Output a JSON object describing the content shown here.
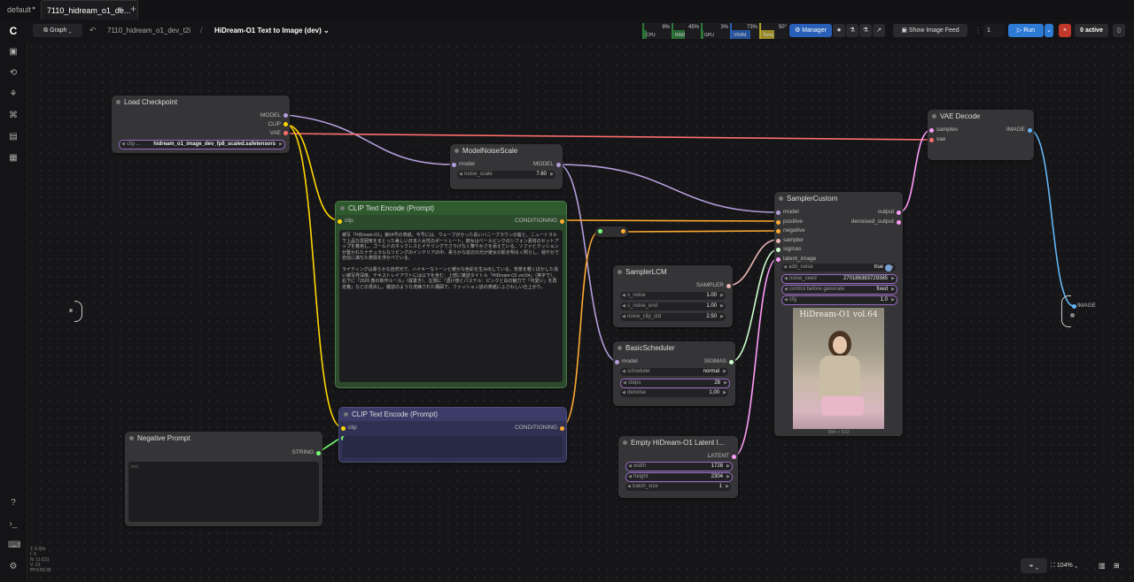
{
  "tabs": [
    {
      "label": "default"
    },
    {
      "label": "7110_hidream_o1_de..."
    }
  ],
  "topbar": {
    "graph_label": "Graph",
    "workflow_path": "7110_hidream_o1_dev_t2i",
    "workflow_title": "HiDream-O1 Text to Image (dev)",
    "stats": [
      {
        "label": "CPU",
        "value": "9%",
        "color": "#2d7a3a"
      },
      {
        "label": "RAM",
        "value": "45%",
        "color": "#2d7a3a"
      },
      {
        "label": "GPU",
        "value": "3%",
        "color": "#2d7a3a"
      },
      {
        "label": "VRAM",
        "value": "73%",
        "color": "#2860b8"
      },
      {
        "label": "Temp",
        "value": "50°",
        "color": "#b8a52a"
      }
    ],
    "manager_label": "Manager",
    "show_feed_label": "Show Image Feed",
    "queue_count": "1",
    "run_label": "Run",
    "active_label": "0 active"
  },
  "nodes": {
    "load_checkpoint": {
      "title": "Load Checkpoint",
      "outputs": [
        "MODEL",
        "CLIP",
        "VAE"
      ],
      "ckpt_label": "clip ...",
      "ckpt_value": "hidream_o1_image_dev_fp8_scaled.safetensors"
    },
    "model_noise_scale": {
      "title": "ModelNoiseScale",
      "input": "model",
      "output": "MODEL",
      "widget_label": "noise_scale",
      "widget_value": "7.60"
    },
    "clip_pos": {
      "title": "CLIP Text Encode (Prompt)",
      "input": "clip",
      "output": "CONDITIONING",
      "text": "被写「HiDream-O1」第64号の表紙。今号には、ウェーブがかった長いハニーブラウンの髪と、ニュートラルで上品な雰囲気をまとった美しい日本人女性のポートレート。彼女はベールピンクのシフォン素材のセットアップを着用し、ゴールドのネックレスとイヤリングでさりげなく華やかさを添えている。ソファとクッションが置かれたナチュラルなリビングのインテリアの中、柔らかな窓辺の光が彼女の肌を明るく照らし、穏やかで自信に満ちた表情を浮かべている。\n\nライティングは柔らかな自然光で、ハイキーなトーンと暖かな色彩を生み出している。背景を軽くぼかした浅い被写界深度。テキストレイアウトには以下を含む：上部に雑誌タイトル「HiDream-O1 vol.64」（英字で）、右下に「2026 春の新作ルール」（縦書き）、左側に「透け感とパステル：ピンクと白の魅力で「可愛い」を再定義」などの見出し。雑誌のような洗練された構図で、ファッション誌の表紙にふさわしい仕上がり。"
    },
    "clip_neg": {
      "title": "CLIP Text Encode (Prompt)",
      "input": "clip",
      "output": "CONDITIONING"
    },
    "negative_prompt": {
      "title": "Negative Prompt",
      "output": "STRING",
      "placeholder": "text"
    },
    "sampler_lcm": {
      "title": "SamplerLCM",
      "output": "SAMPLER",
      "widgets": [
        {
          "label": "s_noise",
          "value": "1.00"
        },
        {
          "label": "s_noise_end",
          "value": "1.00"
        },
        {
          "label": "noise_clip_std",
          "value": "2.50"
        }
      ]
    },
    "basic_scheduler": {
      "title": "BasicScheduler",
      "input": "model",
      "output": "SIGMAS",
      "widgets": [
        {
          "label": "scheduler",
          "value": "normal"
        },
        {
          "label": "steps",
          "value": "28"
        },
        {
          "label": "denoise",
          "value": "1.00"
        }
      ]
    },
    "empty_latent": {
      "title": "Empty HiDream-O1 Latent I...",
      "output": "LATENT",
      "widgets": [
        {
          "label": "width",
          "value": "1728"
        },
        {
          "label": "height",
          "value": "2304"
        },
        {
          "label": "batch_size",
          "value": "1"
        }
      ]
    },
    "sampler_custom": {
      "title": "SamplerCustom",
      "inputs": [
        "model",
        "positive",
        "negative",
        "sampler",
        "sigmas",
        "latent_image"
      ],
      "outputs": [
        "output",
        "denoised_output"
      ],
      "add_noise_label": "add_noise",
      "add_noise_value": "true",
      "widgets": [
        {
          "label": "noise_seed",
          "value": "270186383729385"
        },
        {
          "label": "control before generate",
          "value": "fixed"
        },
        {
          "label": "cfg",
          "value": "1.0"
        }
      ],
      "preview_caption": "HiDream-O1 vol.64",
      "preview_size": "384 × 512"
    },
    "vae_decode": {
      "title": "VAE Decode",
      "inputs": [
        "samples",
        "vae"
      ],
      "output": "IMAGE"
    },
    "reroute_image": {
      "label": "IMAGE"
    }
  },
  "zoom": "104%",
  "corner_stats": [
    "T: 0.00s",
    "I: 0",
    "N: 11 [11]",
    "V: 22",
    "FPS:59.92"
  ],
  "colors": {
    "model": "#b39ddb",
    "clip": "#ffd500",
    "vae": "#ff6e6e",
    "conditioning": "#ffa931",
    "latent": "#ff9cf9",
    "image": "#64b5f6",
    "sampler": "#ecb4b4",
    "sigmas": "#cdffcd",
    "string": "#77ff77"
  }
}
